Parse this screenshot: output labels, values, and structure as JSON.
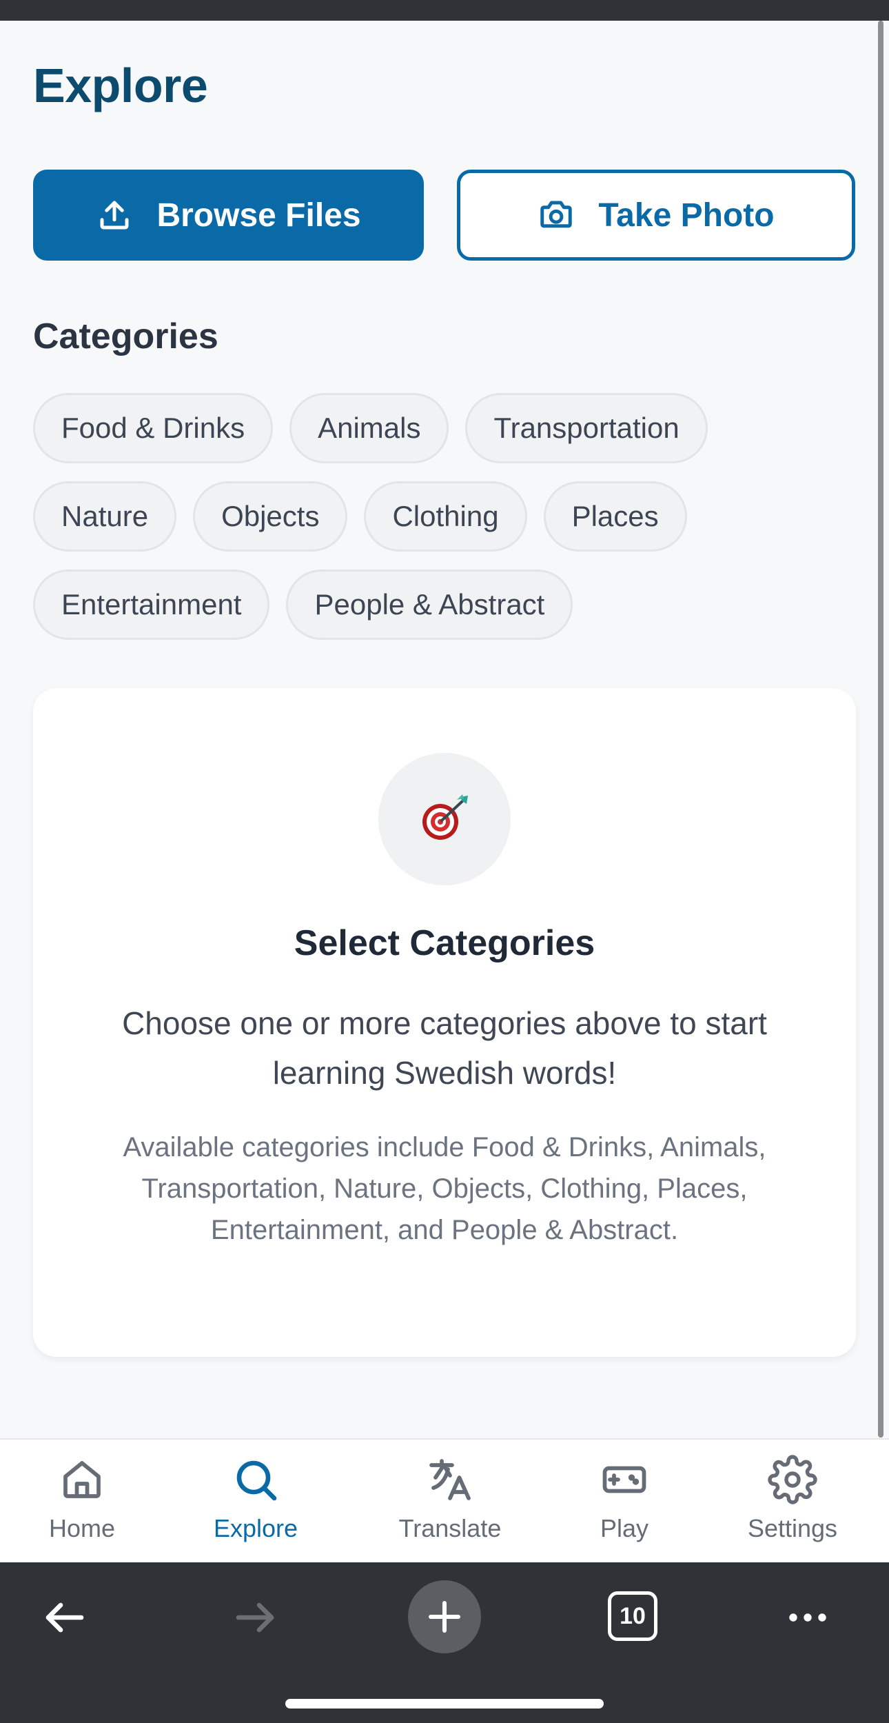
{
  "header": {
    "title": "Explore"
  },
  "actions": {
    "browse_label": "Browse Files",
    "photo_label": "Take Photo"
  },
  "categories": {
    "title": "Categories",
    "items": [
      "Food & Drinks",
      "Animals",
      "Transportation",
      "Nature",
      "Objects",
      "Clothing",
      "Places",
      "Entertainment",
      "People & Abstract"
    ]
  },
  "empty_state": {
    "icon": "target-icon",
    "title": "Select Categories",
    "description": "Choose one or more categories above to start learning Swedish words!",
    "note": "Available categories include Food & Drinks, Animals, Transportation, Nature, Objects, Clothing, Places, Entertainment, and People & Abstract."
  },
  "nav": {
    "items": [
      {
        "label": "Home",
        "icon": "home-icon"
      },
      {
        "label": "Explore",
        "icon": "search-icon",
        "active": true
      },
      {
        "label": "Translate",
        "icon": "translate-icon"
      },
      {
        "label": "Play",
        "icon": "gamepad-icon"
      },
      {
        "label": "Settings",
        "icon": "gear-icon"
      }
    ]
  },
  "browser": {
    "tab_count": "10"
  },
  "colors": {
    "primary": "#0a6aa8",
    "title": "#0c4a6e",
    "browser_bar": "#2f3237"
  }
}
